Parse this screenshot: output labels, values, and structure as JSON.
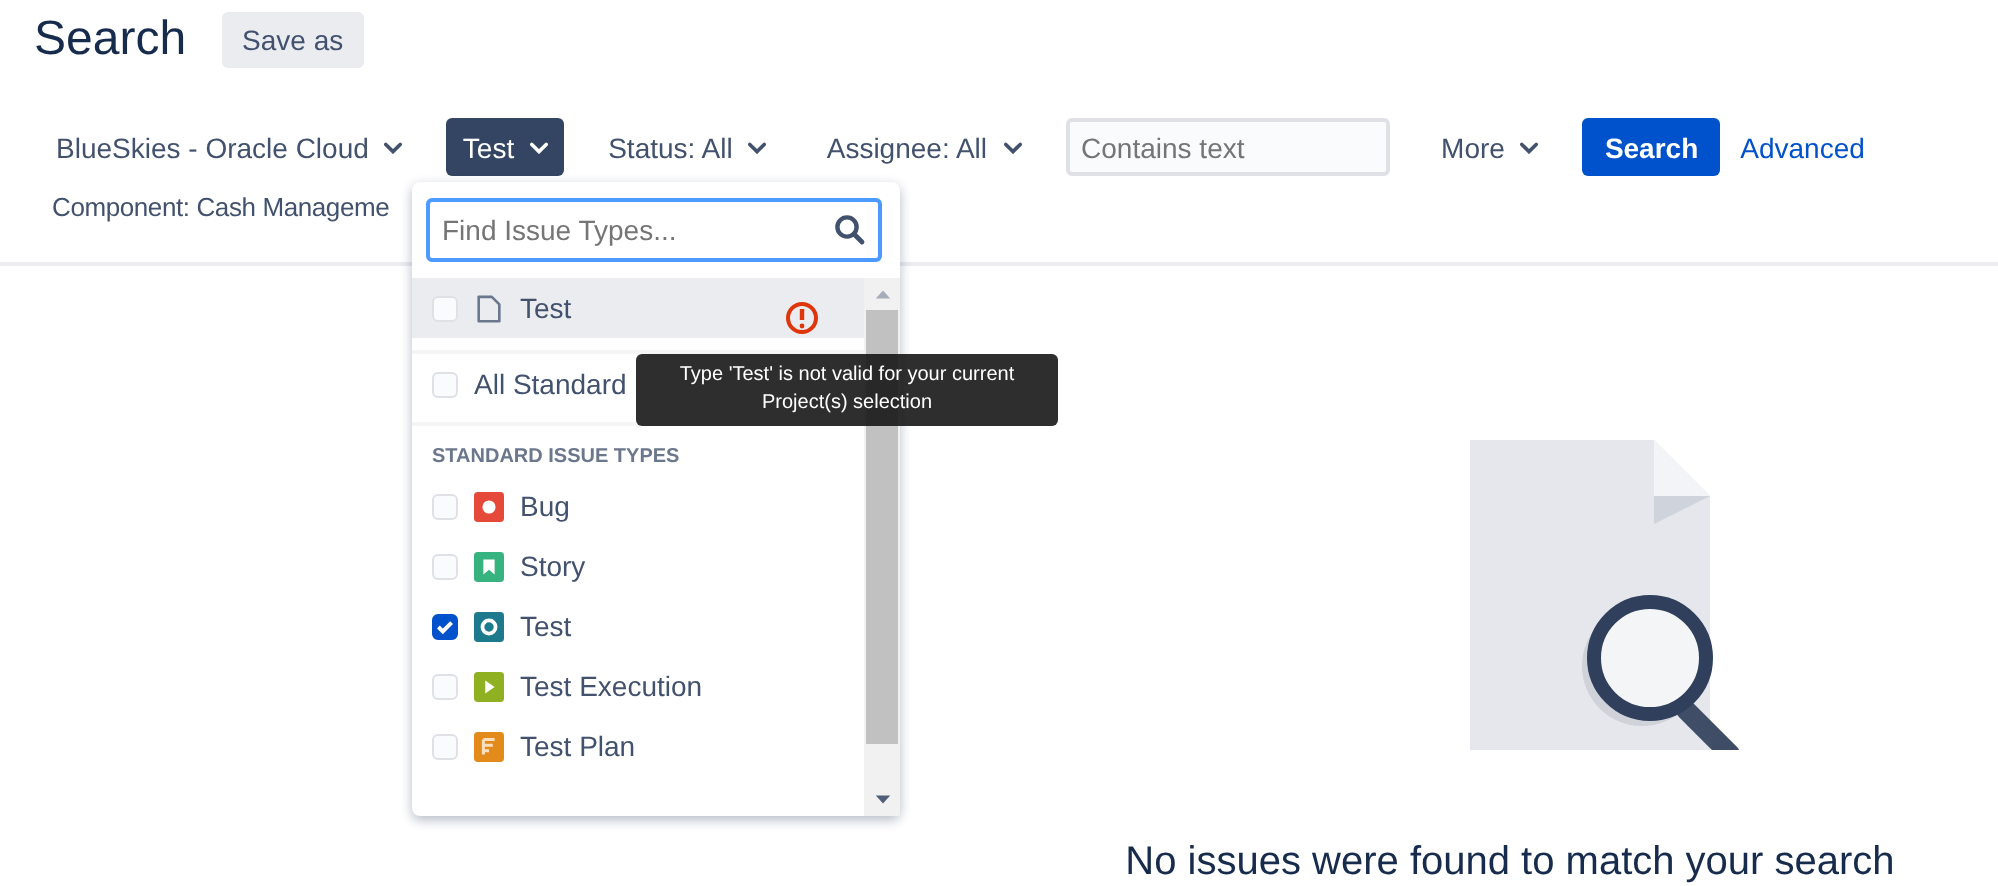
{
  "header": {
    "title": "Search",
    "save_button": "Save as"
  },
  "filters": [
    {
      "kind": "dropdown",
      "label": "BlueSkies - Oracle Cloud",
      "selected": false
    },
    {
      "kind": "dropdown",
      "label": "Test",
      "selected": true
    },
    {
      "kind": "dropdown",
      "label": "Status: All",
      "selected": false
    },
    {
      "kind": "dropdown",
      "label": "Assignee: All",
      "selected": false
    },
    {
      "kind": "text",
      "placeholder": "Contains text"
    },
    {
      "kind": "dropdown",
      "label": "More",
      "selected": false
    },
    {
      "kind": "primary",
      "label": "Search"
    },
    {
      "kind": "link",
      "label": "Advanced"
    }
  ],
  "component_filter": "Component: Cash Manageme",
  "issue_type_menu": {
    "search_placeholder": "Find Issue Types...",
    "top_items": [
      {
        "kind": "invalid",
        "label": "Test",
        "checked": false,
        "highlighted": true
      },
      {
        "kind": "all",
        "label": "All Standard",
        "checked": false,
        "highlighted": false
      }
    ],
    "section_title": "STANDARD ISSUE TYPES",
    "types": [
      {
        "kind": "bug",
        "label": "Bug",
        "checked": false
      },
      {
        "kind": "story",
        "label": "Story",
        "checked": false
      },
      {
        "kind": "test",
        "label": "Test",
        "checked": true
      },
      {
        "kind": "execution",
        "label": "Test Execution",
        "checked": false
      },
      {
        "kind": "plan",
        "label": "Test Plan",
        "checked": false
      }
    ],
    "tooltip": "Type 'Test' is not valid for your current Project(s) selection"
  },
  "empty_message": "No issues were found to match your search"
}
